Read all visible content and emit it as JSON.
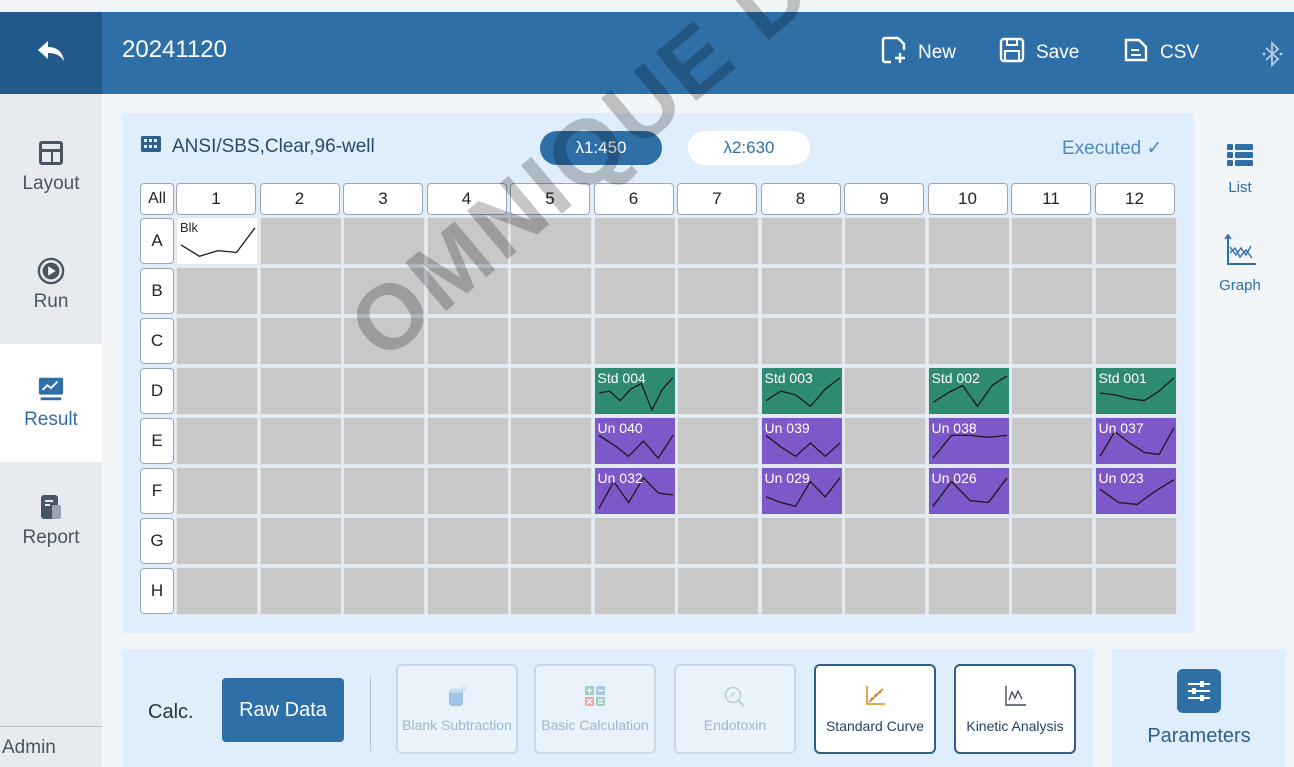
{
  "header": {
    "title": "20241120",
    "new_label": "New",
    "save_label": "Save",
    "csv_label": "CSV",
    "back_icon": "back-arrow-icon",
    "bluetooth_icon": "bluetooth-icon"
  },
  "sidebar": {
    "items": [
      {
        "label": "Layout",
        "icon": "layout-icon"
      },
      {
        "label": "Run",
        "icon": "play-icon"
      },
      {
        "label": "Result",
        "icon": "chart-icon"
      },
      {
        "label": "Report",
        "icon": "report-icon"
      }
    ],
    "active": "Result",
    "footer": "Admin"
  },
  "plate": {
    "type": "ANSI/SBS,Clear,96-well",
    "lambda1": "λ1:450",
    "lambda2": "λ2:630",
    "status": "Executed ✓",
    "all_label": "All",
    "columns": [
      "1",
      "2",
      "3",
      "4",
      "5",
      "6",
      "7",
      "8",
      "9",
      "10",
      "11",
      "12"
    ],
    "rows": [
      "A",
      "B",
      "C",
      "D",
      "E",
      "F",
      "G",
      "H"
    ],
    "wells": [
      {
        "row": "A",
        "col": "1",
        "label": "Blk",
        "type": "blank",
        "trace": [
          0.55,
          0.85,
          0.7,
          0.75,
          0.1
        ]
      },
      {
        "row": "D",
        "col": "6",
        "label": "Std 004",
        "type": "standard",
        "trace": [
          0.5,
          0.45,
          0.7,
          0.4,
          0.25,
          0.95,
          0.4,
          0.1
        ]
      },
      {
        "row": "D",
        "col": "8",
        "label": "Std 003",
        "type": "standard",
        "trace": [
          0.7,
          0.45,
          0.55,
          0.85,
          0.4,
          0.1
        ]
      },
      {
        "row": "D",
        "col": "10",
        "label": "Std 002",
        "type": "standard",
        "trace": [
          0.75,
          0.5,
          0.3,
          0.85,
          0.3,
          0.05
        ]
      },
      {
        "row": "D",
        "col": "12",
        "label": "Std 001",
        "type": "standard",
        "trace": [
          0.5,
          0.55,
          0.65,
          0.7,
          0.45,
          0.1
        ]
      },
      {
        "row": "E",
        "col": "6",
        "label": "Un 040",
        "type": "unknown",
        "trace": [
          0.3,
          0.55,
          0.85,
          0.45,
          0.9,
          0.3
        ]
      },
      {
        "row": "E",
        "col": "8",
        "label": "Un 039",
        "type": "unknown",
        "trace": [
          0.3,
          0.6,
          0.85,
          0.5,
          0.85,
          0.5
        ]
      },
      {
        "row": "E",
        "col": "10",
        "label": "Un 038",
        "type": "unknown",
        "trace": [
          0.9,
          0.3,
          0.3,
          0.35,
          0.3
        ]
      },
      {
        "row": "E",
        "col": "12",
        "label": "Un 037",
        "type": "unknown",
        "trace": [
          0.85,
          0.2,
          0.5,
          0.75,
          0.8,
          0.1
        ]
      },
      {
        "row": "F",
        "col": "6",
        "label": "Un 032",
        "type": "unknown",
        "trace": [
          0.9,
          0.2,
          0.75,
          0.1,
          0.5,
          0.55
        ]
      },
      {
        "row": "F",
        "col": "8",
        "label": "Un 029",
        "type": "unknown",
        "trace": [
          0.6,
          0.75,
          0.85,
          0.2,
          0.6,
          0.1
        ]
      },
      {
        "row": "F",
        "col": "10",
        "label": "Un 026",
        "type": "unknown",
        "trace": [
          0.85,
          0.2,
          0.7,
          0.75,
          0.1
        ]
      },
      {
        "row": "F",
        "col": "12",
        "label": "Un 023",
        "type": "unknown",
        "trace": [
          0.4,
          0.75,
          0.8,
          0.45,
          0.15
        ]
      }
    ]
  },
  "side_tools": {
    "list_label": "List",
    "graph_label": "Graph"
  },
  "bottom": {
    "calc_label": "Calc.",
    "raw_data_label": "Raw Data",
    "functions": [
      {
        "label": "Blank Subtraction",
        "enabled": false,
        "icon": "blank-subtraction-icon"
      },
      {
        "label": "Basic Calculation",
        "enabled": false,
        "icon": "calculator-icon"
      },
      {
        "label": "Endotoxin",
        "enabled": false,
        "icon": "endotoxin-icon"
      },
      {
        "label": "Standard Curve",
        "enabled": true,
        "icon": "standard-curve-icon"
      },
      {
        "label": "Kinetic Analysis",
        "enabled": true,
        "icon": "kinetic-icon"
      }
    ],
    "parameters_label": "Parameters"
  },
  "watermark": "OMNIQUE DUTSCHER",
  "colors": {
    "header": "#2f6fa8",
    "standard": "#2f8a74",
    "unknown": "#7c58c8",
    "empty": "#c8c8c8"
  }
}
